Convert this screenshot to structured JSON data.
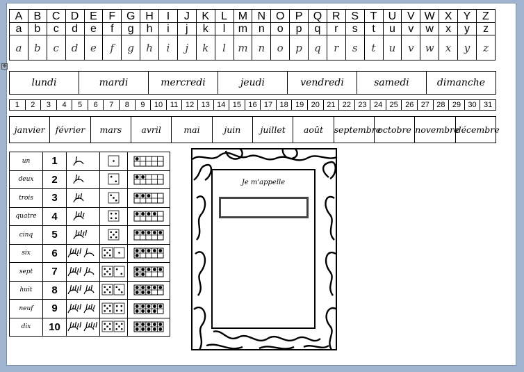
{
  "alphabet": {
    "upper": [
      "A",
      "B",
      "C",
      "D",
      "E",
      "F",
      "G",
      "H",
      "I",
      "J",
      "K",
      "L",
      "M",
      "N",
      "O",
      "P",
      "Q",
      "R",
      "S",
      "T",
      "U",
      "V",
      "W",
      "X",
      "Y",
      "Z"
    ],
    "lower": [
      "a",
      "b",
      "c",
      "d",
      "e",
      "f",
      "g",
      "h",
      "i",
      "j",
      "k",
      "l",
      "m",
      "n",
      "o",
      "p",
      "q",
      "r",
      "s",
      "t",
      "u",
      "v",
      "w",
      "x",
      "y",
      "z"
    ],
    "cursive": [
      "a",
      "b",
      "c",
      "d",
      "e",
      "f",
      "g",
      "h",
      "i",
      "j",
      "k",
      "l",
      "m",
      "n",
      "o",
      "p",
      "q",
      "r",
      "s",
      "t",
      "u",
      "v",
      "w",
      "x",
      "y",
      "z"
    ]
  },
  "days": [
    "lundi",
    "mardi",
    "mercredi",
    "jeudi",
    "vendredi",
    "samedi",
    "dimanche"
  ],
  "dates": [
    "1",
    "2",
    "3",
    "4",
    "5",
    "6",
    "7",
    "8",
    "9",
    "10",
    "11",
    "12",
    "13",
    "14",
    "15",
    "16",
    "17",
    "18",
    "19",
    "20",
    "21",
    "22",
    "23",
    "24",
    "25",
    "26",
    "27",
    "28",
    "29",
    "30",
    "31"
  ],
  "months": [
    "janvier",
    "février",
    "mars",
    "avril",
    "mai",
    "juin",
    "juillet",
    "août",
    "septembre",
    "octobre",
    "novembre",
    "décembre"
  ],
  "counting": [
    {
      "word": "un",
      "digit": "1",
      "value": 1
    },
    {
      "word": "deux",
      "digit": "2",
      "value": 2
    },
    {
      "word": "trois",
      "digit": "3",
      "value": 3
    },
    {
      "word": "quatre",
      "digit": "4",
      "value": 4
    },
    {
      "word": "cinq",
      "digit": "5",
      "value": 5
    },
    {
      "word": "six",
      "digit": "6",
      "value": 6
    },
    {
      "word": "sept",
      "digit": "7",
      "value": 7
    },
    {
      "word": "huit",
      "digit": "8",
      "value": 8
    },
    {
      "word": "neuf",
      "digit": "9",
      "value": 9
    },
    {
      "word": "dix",
      "digit": "10",
      "value": 10
    }
  ],
  "name_card": {
    "title": "Je m'appelle",
    "name_value": ""
  },
  "icons": {
    "hands": "counting-hand-icon",
    "dice": "dice-face-icon",
    "frame": "ten-frame-icon",
    "anchor": "move-handle-icon"
  },
  "colors": {
    "background": "#9fb4cf",
    "page": "#ffffff",
    "ink": "#000000"
  }
}
